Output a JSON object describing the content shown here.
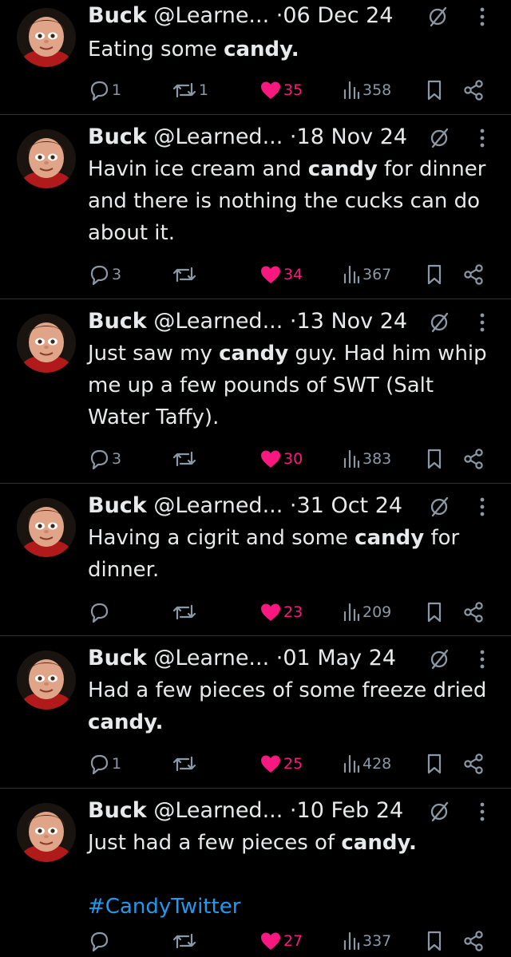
{
  "tweets": [
    {
      "name": "Buck",
      "handle": "@Learne...",
      "date": "06 Dec 24",
      "text_parts": [
        {
          "t": "Eating some ",
          "b": false
        },
        {
          "t": "candy",
          "b": true
        },
        {
          "t": ".",
          "b": true
        }
      ],
      "hashtag": "",
      "replies": "1",
      "reposts": "1",
      "likes": "35",
      "views": "358"
    },
    {
      "name": "Buck",
      "handle": "@Learned...",
      "date": "18 Nov 24",
      "text_parts": [
        {
          "t": "Havin ice cream and ",
          "b": false
        },
        {
          "t": "candy",
          "b": true
        },
        {
          "t": " for dinner and there is nothing the cucks can do about it.",
          "b": false
        }
      ],
      "hashtag": "",
      "replies": "3",
      "reposts": "",
      "likes": "34",
      "views": "367"
    },
    {
      "name": "Buck",
      "handle": "@Learned...",
      "date": "13 Nov 24",
      "text_parts": [
        {
          "t": "Just saw my ",
          "b": false
        },
        {
          "t": "candy",
          "b": true
        },
        {
          "t": " guy. Had him whip me up a few pounds of SWT (Salt Water Taffy).",
          "b": false
        }
      ],
      "hashtag": "",
      "replies": "3",
      "reposts": "",
      "likes": "30",
      "views": "383"
    },
    {
      "name": "Buck",
      "handle": "@Learned...",
      "date": "31 Oct 24",
      "text_parts": [
        {
          "t": "Having a cigrit and some ",
          "b": false
        },
        {
          "t": "candy",
          "b": true
        },
        {
          "t": " for dinner.",
          "b": false
        }
      ],
      "hashtag": "",
      "replies": "",
      "reposts": "",
      "likes": "23",
      "views": "209"
    },
    {
      "name": "Buck",
      "handle": "@Learne...",
      "date": "01 May 24",
      "text_parts": [
        {
          "t": "Had a few pieces of some freeze dried ",
          "b": false
        },
        {
          "t": "candy",
          "b": true
        },
        {
          "t": ".",
          "b": true
        }
      ],
      "hashtag": "",
      "replies": "1",
      "reposts": "",
      "likes": "25",
      "views": "428"
    },
    {
      "name": "Buck",
      "handle": "@Learned...",
      "date": "10 Feb 24",
      "text_parts": [
        {
          "t": "Just had a few pieces of ",
          "b": false
        },
        {
          "t": "candy",
          "b": true
        },
        {
          "t": ".",
          "b": true
        }
      ],
      "hashtag": "#CandyTwitter",
      "replies": "",
      "reposts": "",
      "likes": "27",
      "views": "337"
    }
  ],
  "separator": "·",
  "colors": {
    "background": "#000000",
    "text": "#e7e9ea",
    "muted": "#8b98a5",
    "like": "#f91880",
    "hashtag": "#1d9bf0",
    "divider": "#2f3336"
  },
  "icons": {
    "reply": "reply-icon",
    "repost": "repost-icon",
    "like": "heart-icon",
    "views": "views-icon",
    "bookmark": "bookmark-icon",
    "share": "share-icon",
    "edited": "edited-icon",
    "more": "more-icon"
  }
}
